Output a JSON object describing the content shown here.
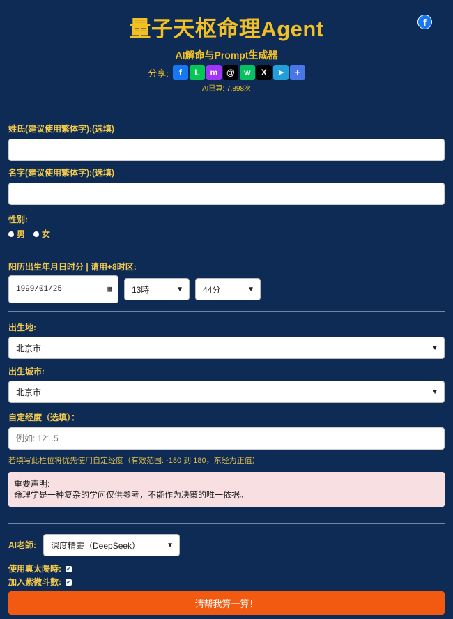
{
  "header": {
    "title": "量子天枢命理Agent",
    "subtitle": "AI解命与Prompt生成器",
    "share_label": "分享:",
    "counter": "AI已算: 7,898次"
  },
  "share_buttons": [
    {
      "icon": "facebook-icon",
      "glyph": "f",
      "color": "#1877f2"
    },
    {
      "icon": "line-icon",
      "glyph": "L",
      "color": "#06c755"
    },
    {
      "icon": "messenger-icon",
      "glyph": "m",
      "color": "#a334fa"
    },
    {
      "icon": "threads-icon",
      "glyph": "@",
      "color": "#000000"
    },
    {
      "icon": "wechat-icon",
      "glyph": "w",
      "color": "#07c160"
    },
    {
      "icon": "x-icon",
      "glyph": "X",
      "color": "#000000"
    },
    {
      "icon": "telegram-icon",
      "glyph": "➤",
      "color": "#229ed9"
    },
    {
      "icon": "more-icon",
      "glyph": "+",
      "color": "#4a77e8"
    }
  ],
  "form": {
    "surname_label": "姓氏(建议使用繁体字):(选填)",
    "surname_value": "",
    "name_label": "名字(建议使用繁体字):(选填)",
    "name_value": "",
    "gender_label": "性别:",
    "gender_male": "男",
    "gender_female": "女",
    "birth_label": "阳历出生年月日时分 | 请用+8时区:",
    "birth_date": "1999/01/25",
    "birth_hour": "13時",
    "birth_minute": "44分",
    "birthplace_label": "出生地:",
    "birthplace_value": "北京市",
    "city_label": "出生城市:",
    "city_value": "北京市",
    "longitude_label": "自定经度（选填）：",
    "longitude_placeholder": "例如: 121.5",
    "longitude_hint": "若填写此栏位将优先使用自定经度（有效范围: -180 到 180，东经为正值）",
    "notice_title": "重要声明:",
    "notice_body": "命理学是一种复杂的学问仅供参考，不能作为决策的唯一依据。",
    "ai_label": "AI老師:",
    "ai_value": "深度精靈（DeepSeek）",
    "true_solar_label": "使用真太陽時:",
    "ziwei_label": "加入紫微斗數:",
    "submit_label": "请帮我算一算！"
  },
  "colors": {
    "background": "#0d2b55",
    "label": "#f2c94c",
    "submit": "#f25a12",
    "notice_bg": "#f7dfe2"
  }
}
